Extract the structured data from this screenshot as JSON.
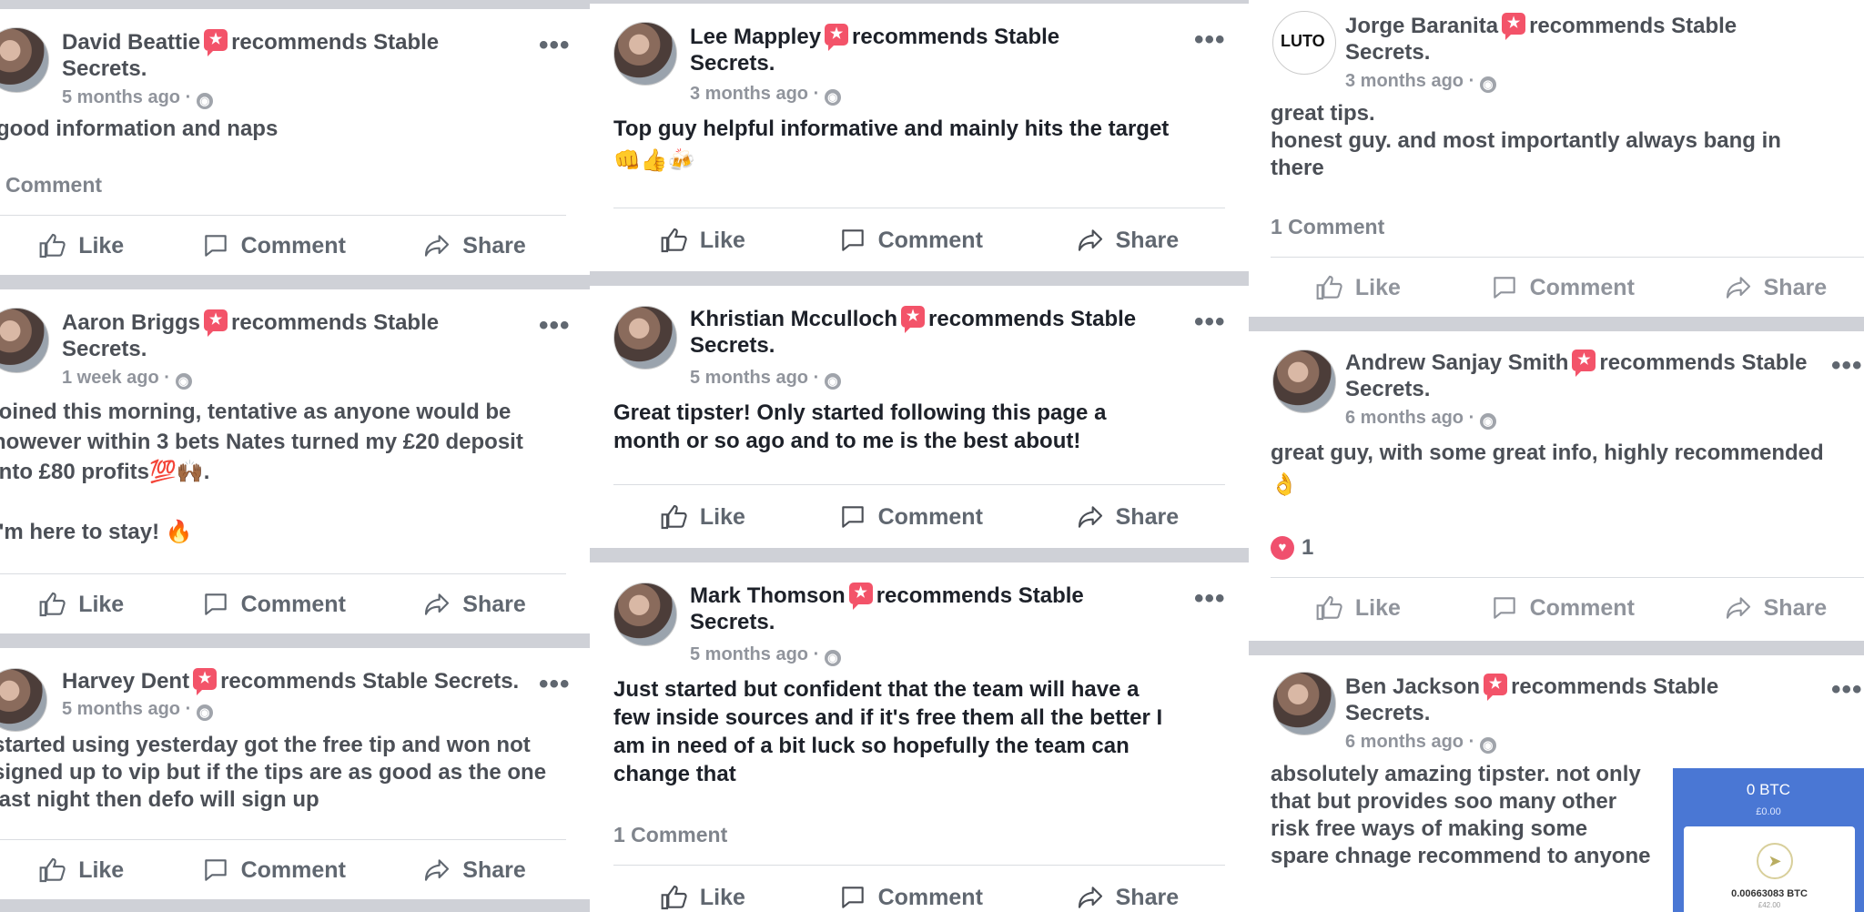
{
  "common": {
    "recommends": "recommends Stable",
    "secrets": "Secrets.",
    "like": "Like",
    "comment": "Comment",
    "share": "Share",
    "dot": "·",
    "more": "•••",
    "globe": "◉"
  },
  "col1": [
    {
      "name": "David Beattie",
      "time": "5 months ago",
      "text": "good information and naps",
      "comments": "Comment"
    },
    {
      "name": "Aaron Briggs",
      "time": "1 week ago",
      "text": "joined this morning, tentative as anyone would be\nhowever within 3 bets Nates turned my £20 deposit\ninto £80 profits💯🙌🏾.\n\nI'm here to stay! 🔥"
    },
    {
      "name": "Harvey Dent",
      "full": "recommends Stable Secrets.",
      "time": "5 months ago",
      "text": "started using yesterday got the free tip and won not\nsigned up to vip but if the tips are as good as the one\nlast night then defo will sign up"
    }
  ],
  "col2": [
    {
      "name": "Lee Mappley",
      "time": "3 months ago",
      "text": "Top guy helpful informative and mainly hits the target",
      "emoji": "👊👍🍻"
    },
    {
      "name": "Khristian Mcculloch",
      "time": "5 months ago",
      "text": "Great tipster! Only started following this page a\nmonth or so ago and to me is the best about!"
    },
    {
      "name": "Mark Thomson",
      "time": "5 months ago",
      "text": "Just started but confident that the team will have a\nfew inside sources and if it's free them all the better I\nam in need of a bit luck so hopefully the team can\nchange that",
      "comments": "1 Comment"
    }
  ],
  "col3": [
    {
      "name": "Jorge Baranita",
      "time": "3 months ago",
      "text": "great tips.\nhonest guy. and most importantly always bang in\nthere",
      "comments": "1 Comment",
      "avatar_text": "LUTO"
    },
    {
      "name": "Andrew Sanjay Smith",
      "time": "6 months ago",
      "text": "great guy, with some great info, highly recommended",
      "emoji": "👌",
      "reactions": "1"
    },
    {
      "name": "Ben Jackson",
      "time": "6 months ago",
      "text": "absolutely amazing tipster. not only\nthat but provides soo many other\nrisk free ways of making some\nspare chnage recommend to anyone"
    }
  ],
  "btc": {
    "amount": "0 BTC",
    "fiat": "£0.00",
    "amount2": "0.00663083 BTC",
    "fiat2": "£42.00"
  }
}
